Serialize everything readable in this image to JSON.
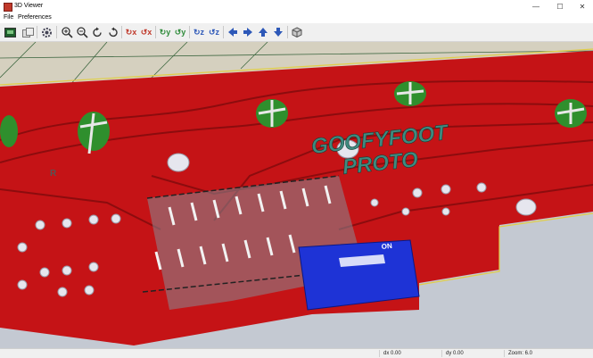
{
  "window": {
    "title": "3D Viewer"
  },
  "window_controls": {
    "minimize": "—",
    "maximize": "☐",
    "close": "✕"
  },
  "menu": {
    "items": [
      "File",
      "Preferences"
    ]
  },
  "toolbar": {
    "buttons": [
      "reload-board",
      "copy-image",
      "settings",
      "zoom-in",
      "zoom-out",
      "rotate-ccw",
      "rotate-cw",
      "rotate-x-cw",
      "rotate-x-ccw",
      "rotate-y-cw",
      "rotate-y-ccw",
      "rotate-z-cw",
      "rotate-z-ccw",
      "pan-left",
      "pan-right",
      "pan-up",
      "pan-down",
      "ortho-toggle"
    ]
  },
  "board": {
    "silkscreen_line1": "GOOFYFOOT",
    "silkscreen_line2": "PROTO",
    "label_r": "R",
    "switch_label": "ON",
    "colors": {
      "copper": "#c21014",
      "silk": "#3f8a7f",
      "mask_green": "#2f8f2d",
      "switch": "#1e33d6",
      "substrate": "#d3cbb6"
    }
  },
  "status": {
    "dx": "dx 0.00",
    "dy": "dy 0.00",
    "zoom": "Zoom: 6.0"
  }
}
